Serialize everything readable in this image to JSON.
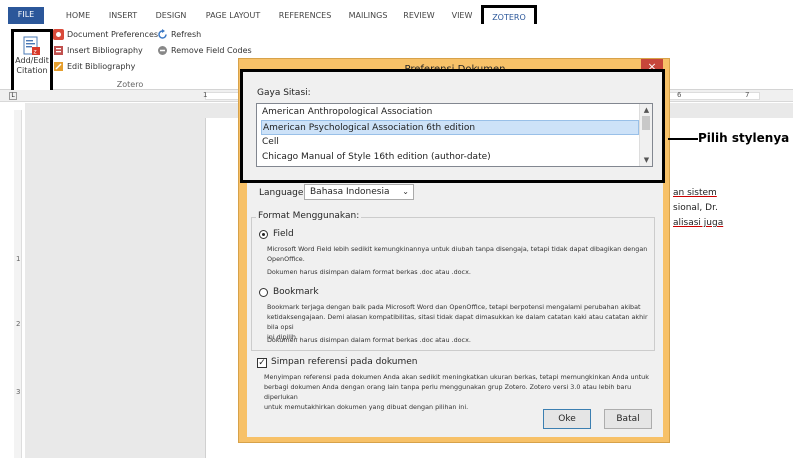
{
  "ribbon_tabs": [
    "FILE",
    "HOME",
    "INSERT",
    "DESIGN",
    "PAGE LAYOUT",
    "REFERENCES",
    "MAILINGS",
    "REVIEW",
    "VIEW",
    "ZOTERO"
  ],
  "ribbon": {
    "add_edit_line1": "Add/Edit",
    "add_edit_line2": "Citation",
    "document_preferences": "Document Preferences",
    "insert_bibliography": "Insert Bibliography",
    "edit_bibliography": "Edit Bibliography",
    "refresh": "Refresh",
    "remove_field_codes": "Remove Field Codes",
    "group_label": "Zotero"
  },
  "ruler": {
    "corner": "L",
    "marks": [
      "1",
      "6",
      "7"
    ],
    "vmarks": [
      "1",
      "2",
      "3"
    ]
  },
  "document": {
    "line1": "an sistem",
    "line2": "sional, Dr.",
    "line3": "alisasi juga"
  },
  "dialog": {
    "title": "Preferensi Dokumen",
    "close": "×",
    "gaya_label": "Gaya Sitasi:",
    "styles": [
      "American Anthropological Association",
      "American Psychological Association 6th edition",
      "Cell",
      "Chicago Manual of Style 16th edition (author-date)"
    ],
    "selected_style_index": 1,
    "language_label": "Language:",
    "language_value": "Bahasa Indonesia",
    "format_legend": "Format Menggunakan:",
    "field_label": "Field",
    "field_desc1": "Microsoft Word Field lebih sedikit kemungkinannya untuk diubah tanpa disengaja, tetapi tidak dapat dibagikan dengan",
    "field_desc2": "OpenOffice.",
    "field_desc3": "Dokumen harus disimpan dalam format berkas .doc atau .docx.",
    "bookmark_label": "Bookmark",
    "bookmark_desc1": "Bookmark terjaga dengan baik pada Microsoft Word dan OpenOffice, tetapi berpotensi mengalami perubahan akibat",
    "bookmark_desc2": "ketidaksengajaan. Demi alasan kompatibilitas, sitasi tidak dapat dimasukkan ke dalam catatan kaki atau catatan akhir bila opsi",
    "bookmark_desc3": "ini dipilih.",
    "bookmark_desc4": "Dokumen harus disimpan dalam format berkas .doc atau .docx.",
    "checkbox_label": "Simpan referensi pada dokumen",
    "checkbox_desc1": "Menyimpan referensi pada dokumen Anda akan sedikit meningkatkan ukuran berkas, tetapi memungkinkan Anda untuk",
    "checkbox_desc2": "berbagi dokumen Anda dengan orang lain tanpa perlu menggunakan grup Zotero. Zotero versi 3.0 atau lebih baru diperlukan",
    "checkbox_desc3": "untuk memutakhirkan dokumen yang dibuat dengan pilihan ini.",
    "ok": "Oke",
    "cancel": "Batal"
  },
  "annotation": {
    "callout": "Pilih stylenya"
  },
  "colors": {
    "file_tab": "#2b579a",
    "dialog_frame": "#f7c168",
    "close": "#c7463a",
    "selection": "#cde2f8"
  }
}
